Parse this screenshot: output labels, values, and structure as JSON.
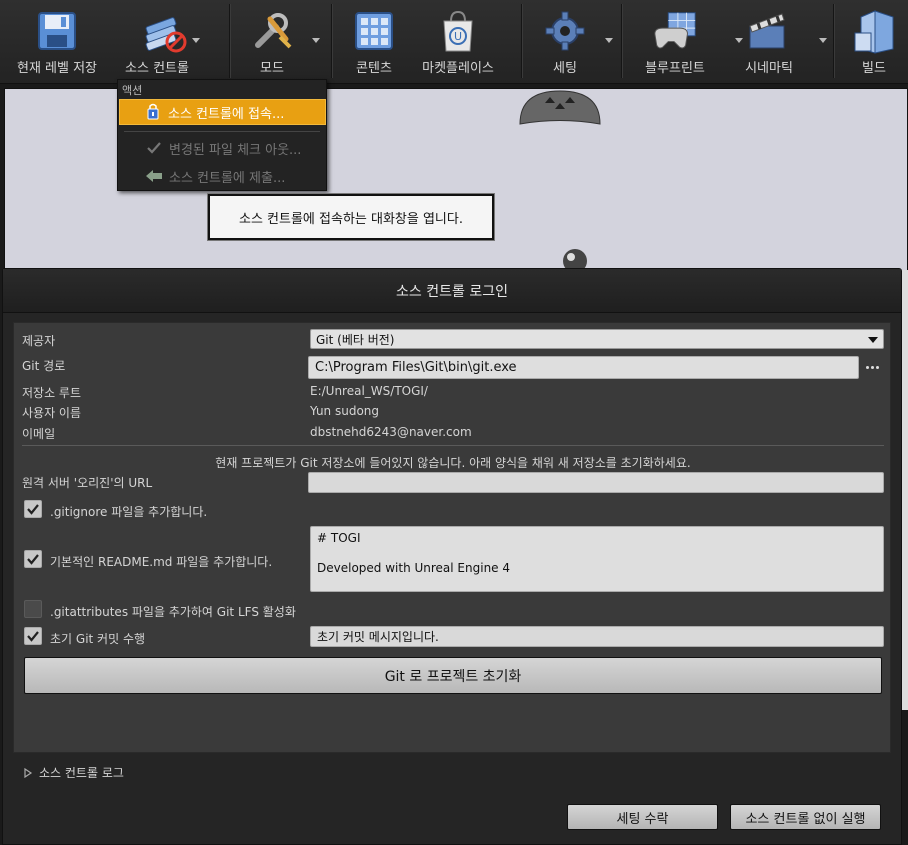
{
  "toolbar": {
    "items": [
      {
        "label": "현재 레벨 저장",
        "icon": "save-icon"
      },
      {
        "label": "소스 컨트롤",
        "icon": "source-control-icon"
      },
      {
        "label": "모드",
        "icon": "modes-icon"
      },
      {
        "label": "콘텐츠",
        "icon": "content-icon"
      },
      {
        "label": "마켓플레이스",
        "icon": "marketplace-icon"
      },
      {
        "label": "세팅",
        "icon": "settings-icon"
      },
      {
        "label": "블루프린트",
        "icon": "blueprint-icon"
      },
      {
        "label": "시네마틱",
        "icon": "cinematics-icon"
      },
      {
        "label": "빌드",
        "icon": "build-icon"
      }
    ]
  },
  "menu": {
    "header": "액션",
    "items": [
      {
        "label": "소스 컨트롤에 접속...",
        "state": "highlighted",
        "icon": "connect-icon"
      },
      {
        "label": "변경된 파일 체크 아웃...",
        "state": "disabled",
        "icon": "checkmark-icon"
      },
      {
        "label": "소스 컨트롤에 제출...",
        "state": "disabled",
        "icon": "submit-arrow-icon"
      }
    ]
  },
  "tooltip": {
    "text": "소스 컨트롤에 접속하는 대화창을 엽니다."
  },
  "dialog": {
    "title": "소스 컨트롤 로그인",
    "provider_label": "제공자",
    "provider_value": "Git (베타 버전)",
    "git_path_label": "Git 경로",
    "git_path_value": "C:\\Program Files\\Git\\bin\\git.exe",
    "repo_root_label": "저장소 루트",
    "repo_root_value": "E:/Unreal_WS/TOGI/",
    "username_label": "사용자 이름",
    "username_value": "Yun sudong",
    "email_label": "이메일",
    "email_value": "dbstnehd6243@naver.com",
    "notice": "현재 프로젝트가 Git 저장소에 들어있지 않습니다. 아래 양식을 채워 새 저장소를 초기화하세요.",
    "remote_url_label": "원격 서버 '오리진'의 URL",
    "remote_url_value": "",
    "gitignore_label": ".gitignore 파일을 추가합니다.",
    "gitignore_checked": true,
    "readme_label": "기본적인 README.md 파일을 추가합니다.",
    "readme_checked": true,
    "readme_line1": "# TOGI",
    "readme_line2": "Developed with Unreal Engine 4",
    "gitattributes_label": ".gitattributes 파일을 추가하여 Git LFS 활성화",
    "gitattributes_checked": false,
    "initial_commit_label": "초기 Git 커밋 수행",
    "initial_commit_checked": true,
    "commit_message": "초기 커밋 메시지입니다.",
    "init_button": "Git 로 프로젝트 초기화",
    "log_label": "소스 컨트롤 로그",
    "accept_button": "세팅 수락",
    "run_without_button": "소스 컨트롤 없이 실행"
  }
}
